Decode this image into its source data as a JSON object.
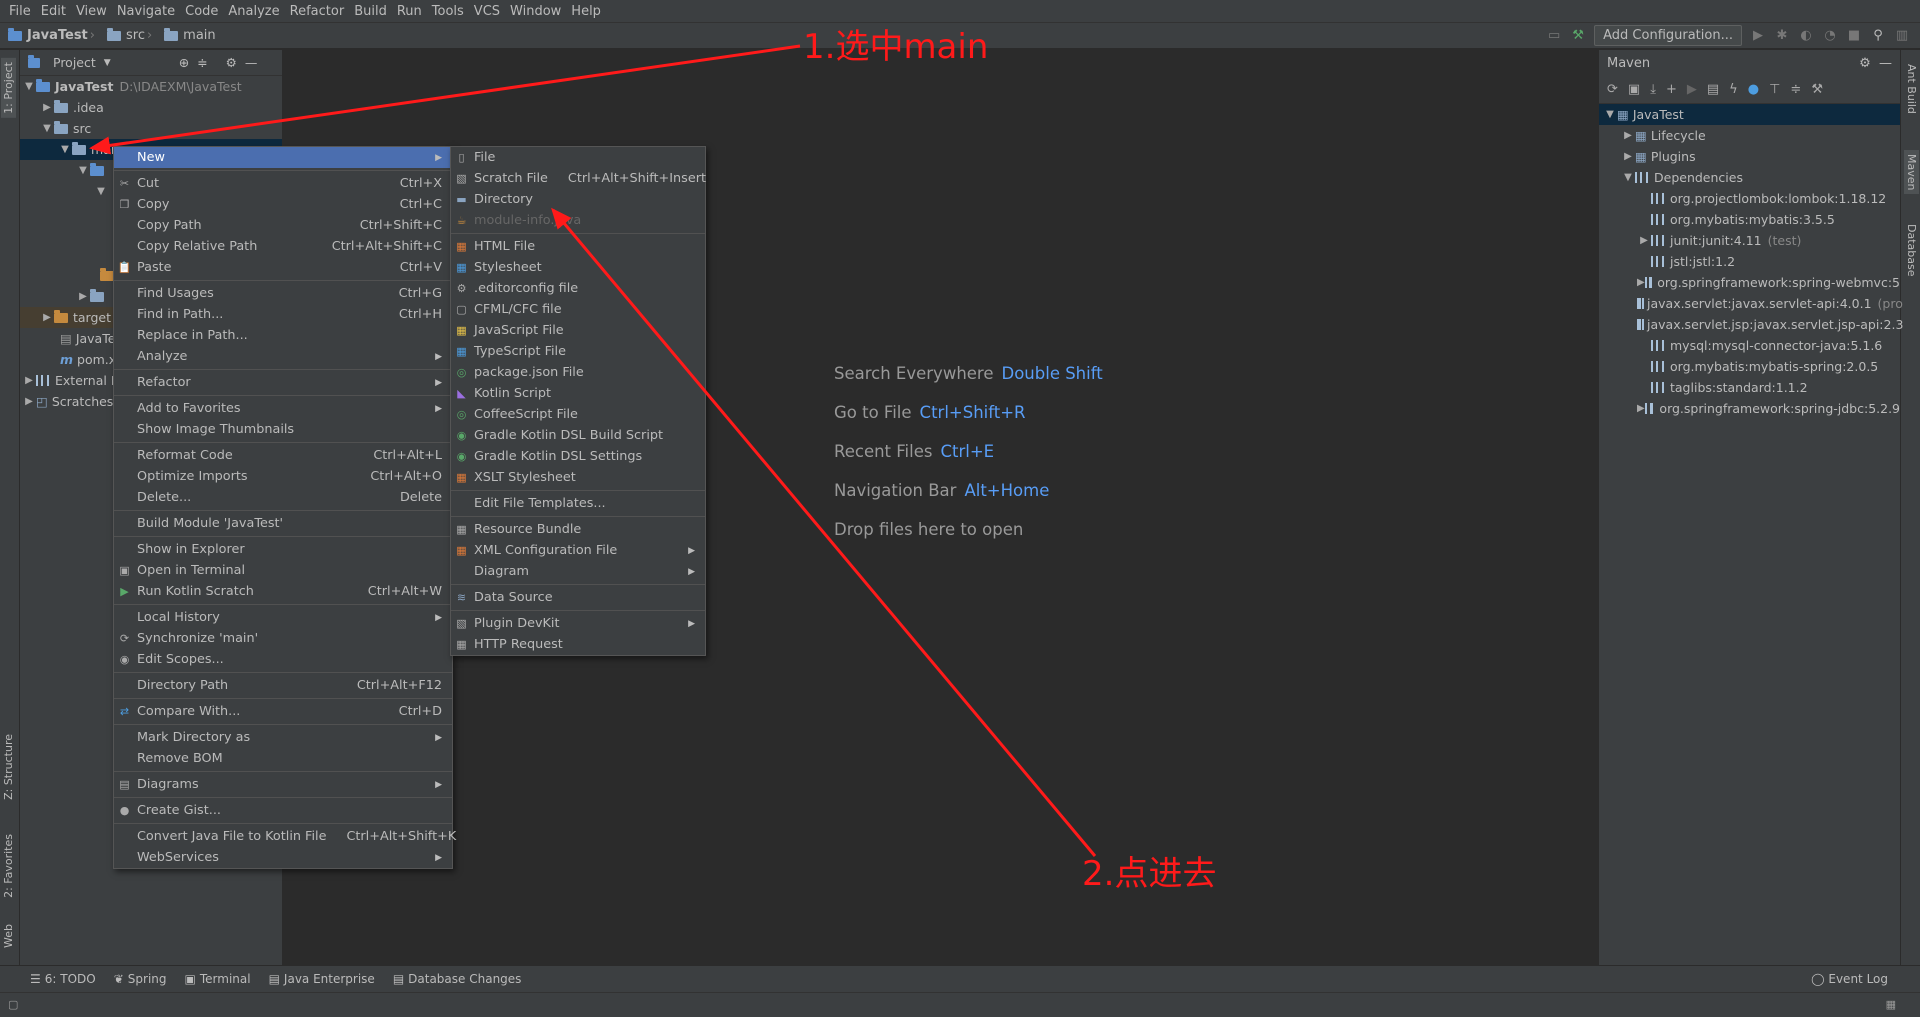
{
  "menubar": [
    "File",
    "Edit",
    "View",
    "Navigate",
    "Code",
    "Analyze",
    "Refactor",
    "Build",
    "Run",
    "Tools",
    "VCS",
    "Window",
    "Help"
  ],
  "breadcrumbs": [
    "JavaTest",
    "src",
    "main"
  ],
  "run_toolbar": {
    "add_config": "Add Configuration..."
  },
  "left_tabs": {
    "project": "1: Project",
    "structure": "Z: Structure",
    "favorites": "2: Favorites",
    "web": "Web"
  },
  "right_tabs": {
    "ant": "Ant Build",
    "maven": "Maven",
    "database": "Database"
  },
  "project_panel": {
    "title": "Project",
    "tree": [
      {
        "label": "JavaTest",
        "detail": "D:\\IDAEXM\\JavaTest"
      },
      {
        "label": ".idea"
      },
      {
        "label": "src"
      },
      {
        "label": "mai"
      },
      {
        "label": "target"
      },
      {
        "label": "JavaTe"
      },
      {
        "label": "pom.x"
      },
      {
        "label": "External L"
      },
      {
        "label": "Scratches"
      }
    ]
  },
  "context_menu": [
    {
      "label": "New",
      "sub": true,
      "selected": true
    },
    {
      "sep": true
    },
    {
      "label": "Cut",
      "sc": "Ctrl+X",
      "icon": "scissors-icon"
    },
    {
      "label": "Copy",
      "sc": "Ctrl+C",
      "icon": "copy-icon"
    },
    {
      "label": "Copy Path",
      "sc": "Ctrl+Shift+C"
    },
    {
      "label": "Copy Relative Path",
      "sc": "Ctrl+Alt+Shift+C"
    },
    {
      "label": "Paste",
      "sc": "Ctrl+V",
      "icon": "paste-icon"
    },
    {
      "sep": true
    },
    {
      "label": "Find Usages",
      "sc": "Ctrl+G"
    },
    {
      "label": "Find in Path...",
      "sc": "Ctrl+H"
    },
    {
      "label": "Replace in Path..."
    },
    {
      "label": "Analyze",
      "sub": true
    },
    {
      "sep": true
    },
    {
      "label": "Refactor",
      "sub": true
    },
    {
      "sep": true
    },
    {
      "label": "Add to Favorites",
      "sub": true
    },
    {
      "label": "Show Image Thumbnails"
    },
    {
      "sep": true
    },
    {
      "label": "Reformat Code",
      "sc": "Ctrl+Alt+L"
    },
    {
      "label": "Optimize Imports",
      "sc": "Ctrl+Alt+O"
    },
    {
      "label": "Delete...",
      "sc": "Delete"
    },
    {
      "sep": true
    },
    {
      "label": "Build Module 'JavaTest'"
    },
    {
      "sep": true
    },
    {
      "label": "Show in Explorer"
    },
    {
      "label": "Open in Terminal",
      "icon": "terminal-icon"
    },
    {
      "label": "Run Kotlin Scratch",
      "sc": "Ctrl+Alt+W",
      "icon": "run-icon"
    },
    {
      "sep": true
    },
    {
      "label": "Local History",
      "sub": true
    },
    {
      "label": "Synchronize 'main'",
      "icon": "sync-icon"
    },
    {
      "label": "Edit Scopes...",
      "icon": "scope-icon"
    },
    {
      "sep": true
    },
    {
      "label": "Directory Path",
      "sc": "Ctrl+Alt+F12"
    },
    {
      "sep": true
    },
    {
      "label": "Compare With...",
      "sc": "Ctrl+D",
      "icon": "compare-icon"
    },
    {
      "sep": true
    },
    {
      "label": "Mark Directory as",
      "sub": true
    },
    {
      "label": "Remove BOM"
    },
    {
      "sep": true
    },
    {
      "label": "Diagrams",
      "sub": true,
      "icon": "diagram-icon"
    },
    {
      "sep": true
    },
    {
      "label": "Create Gist...",
      "icon": "github-icon"
    },
    {
      "sep": true
    },
    {
      "label": "Convert Java File to Kotlin File",
      "sc": "Ctrl+Alt+Shift+K"
    },
    {
      "label": "WebServices",
      "sub": true
    }
  ],
  "new_submenu": [
    {
      "label": "File",
      "icon": "file-icon"
    },
    {
      "label": "Scratch File",
      "sc": "Ctrl+Alt+Shift+Insert",
      "icon": "scratch-icon"
    },
    {
      "label": "Directory",
      "icon": "folder-icon"
    },
    {
      "label": "module-info.java",
      "disabled": true,
      "icon": "java-icon"
    },
    {
      "sep": true
    },
    {
      "label": "HTML File",
      "icon": "html-icon"
    },
    {
      "label": "Stylesheet",
      "icon": "css-icon"
    },
    {
      "label": ".editorconfig file",
      "icon": "gear-icon"
    },
    {
      "label": "CFML/CFC file",
      "icon": "cfml-icon"
    },
    {
      "label": "JavaScript File",
      "icon": "js-icon"
    },
    {
      "label": "TypeScript File",
      "icon": "ts-icon"
    },
    {
      "label": "package.json File",
      "icon": "npm-icon"
    },
    {
      "label": "Kotlin Script",
      "icon": "kotlin-icon"
    },
    {
      "label": "CoffeeScript File",
      "icon": "coffee-icon"
    },
    {
      "label": "Gradle Kotlin DSL Build Script",
      "icon": "gradle-icon"
    },
    {
      "label": "Gradle Kotlin DSL Settings",
      "icon": "gradle-icon"
    },
    {
      "label": "XSLT Stylesheet",
      "icon": "xslt-icon"
    },
    {
      "sep": true
    },
    {
      "label": "Edit File Templates..."
    },
    {
      "sep": true
    },
    {
      "label": "Resource Bundle",
      "icon": "bundle-icon"
    },
    {
      "label": "XML Configuration File",
      "sub": true,
      "icon": "xml-icon"
    },
    {
      "label": "Diagram",
      "sub": true
    },
    {
      "sep": true
    },
    {
      "label": "Data Source",
      "sub": false,
      "icon": "database-icon"
    },
    {
      "sep": true
    },
    {
      "label": "Plugin DevKit",
      "sub": true,
      "icon": "plugin-icon"
    },
    {
      "label": "HTTP Request",
      "icon": "http-icon"
    }
  ],
  "editor_hints": [
    {
      "label": "Search Everywhere",
      "key": "Double Shift"
    },
    {
      "label": "Go to File",
      "key": "Ctrl+Shift+R"
    },
    {
      "label": "Recent Files",
      "key": "Ctrl+E"
    },
    {
      "label": "Navigation Bar",
      "key": "Alt+Home"
    },
    {
      "label": "Drop files here to open",
      "key": ""
    }
  ],
  "maven": {
    "title": "Maven",
    "root": "JavaTest",
    "groups": [
      "Lifecycle",
      "Plugins",
      "Dependencies"
    ],
    "deps": [
      {
        "name": "org.projectlombok:lombok:1.18.12"
      },
      {
        "name": "org.mybatis:mybatis:3.5.5"
      },
      {
        "name": "junit:junit:4.11",
        "tag": "(test)",
        "expand": true
      },
      {
        "name": "jstl:jstl:1.2"
      },
      {
        "name": "org.springframework:spring-webmvc:5",
        "expand": true
      },
      {
        "name": "javax.servlet:javax.servlet-api:4.0.1",
        "tag": "(pro"
      },
      {
        "name": "javax.servlet.jsp:javax.servlet.jsp-api:2.3"
      },
      {
        "name": "mysql:mysql-connector-java:5.1.6"
      },
      {
        "name": "org.mybatis:mybatis-spring:2.0.5"
      },
      {
        "name": "taglibs:standard:1.1.2"
      },
      {
        "name": "org.springframework:spring-jdbc:5.2.9",
        "expand": true
      }
    ]
  },
  "bottom_tabs": [
    "6: TODO",
    "Spring",
    "Terminal",
    "Java Enterprise",
    "Database Changes"
  ],
  "event_log": "Event Log",
  "annotations": {
    "step1": "1.选中main",
    "step2": "2.点进去"
  },
  "colors": {
    "selection": "#4b6eaf",
    "tree_selection": "#0d293e",
    "annotation": "#ff1a1a",
    "link": "#589df6"
  }
}
